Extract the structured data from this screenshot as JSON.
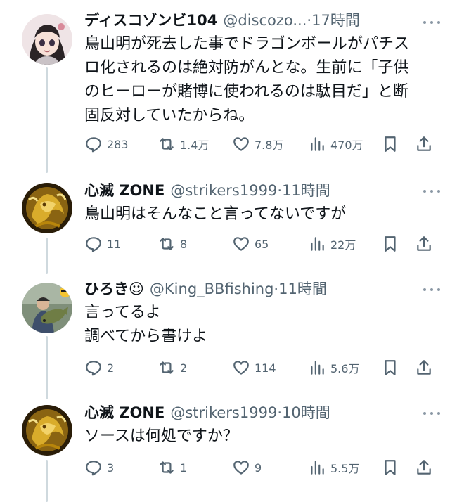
{
  "tweets": [
    {
      "display_name": "ディスコゾンビ104",
      "handle": "@discozo...",
      "dot": "·",
      "time": "17時間",
      "text": "鳥山明が死去した事でドラゴンボールがパチス\nロ化されるのは絶対防がんとな。生前に「子供\nのヒーローが賭博に使われるのは駄目だ」と断\n固反対していたからね。",
      "replies": "283",
      "retweets": "1.4万",
      "likes": "7.8万",
      "views": "470万",
      "avatar": "anime-girl-avatar"
    },
    {
      "display_name": "心滅 ZONE",
      "handle": "@strikers1999",
      "dot": "·",
      "time": "11時間",
      "text": "鳥山明はそんなこと言ってないですが",
      "replies": "11",
      "retweets": "8",
      "likes": "65",
      "views": "22万",
      "avatar": "gold-dragon-avatar"
    },
    {
      "display_name": "ひろき☺",
      "handle": "@King_BBfishing",
      "dot": "·",
      "time": "11時間",
      "text": "言ってるよ\n調べてから書けよ",
      "replies": "2",
      "retweets": "2",
      "likes": "114",
      "views": "5.6万",
      "avatar": "fishing-photo-avatar"
    },
    {
      "display_name": "心滅 ZONE",
      "handle": "@strikers1999",
      "dot": "·",
      "time": "10時間",
      "text": "ソースは何処ですか？",
      "replies": "3",
      "retweets": "1",
      "likes": "9",
      "views": "5.5万",
      "avatar": "gold-dragon-avatar"
    }
  ],
  "colors": {
    "text": "#0f1419",
    "secondary": "#536471",
    "thread_line": "#cfd9de"
  },
  "icons": [
    "reply-icon",
    "retweet-icon",
    "like-icon",
    "views-icon",
    "bookmark-icon",
    "share-icon",
    "more-icon"
  ]
}
